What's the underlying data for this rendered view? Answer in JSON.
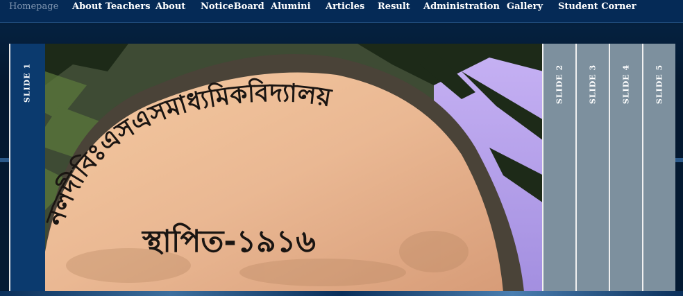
{
  "nav": {
    "items": [
      {
        "label": "Homepage",
        "active": true
      },
      {
        "label": "About Teachers",
        "active": false
      },
      {
        "label": "About",
        "active": false
      },
      {
        "label": "NoticeBoard",
        "active": false
      },
      {
        "label": "Alumini",
        "active": false
      },
      {
        "label": "Articles",
        "active": false
      },
      {
        "label": "Result",
        "active": false
      },
      {
        "label": "Administration",
        "active": false
      },
      {
        "label": "Gallery",
        "active": false
      },
      {
        "label": "Student Corner",
        "active": false
      }
    ]
  },
  "slider": {
    "tabs": [
      {
        "label": "SLIDE 1"
      },
      {
        "label": "SLIDE 2"
      },
      {
        "label": "SLIDE 3"
      },
      {
        "label": "SLIDE 4"
      },
      {
        "label": "SLIDE 5"
      }
    ],
    "active_index": 0,
    "image": {
      "arch_text": "নলদীবিঃএসএসমাধ্যমিকবিদ্যালয়",
      "date_text": "স্থাপিত-১৯১৬"
    }
  },
  "colors": {
    "nav_bg": "#052a56",
    "active_tab": "#0b3a6e",
    "inactive_tab": "#7d909e",
    "nav_active_text": "#7f95b0"
  }
}
